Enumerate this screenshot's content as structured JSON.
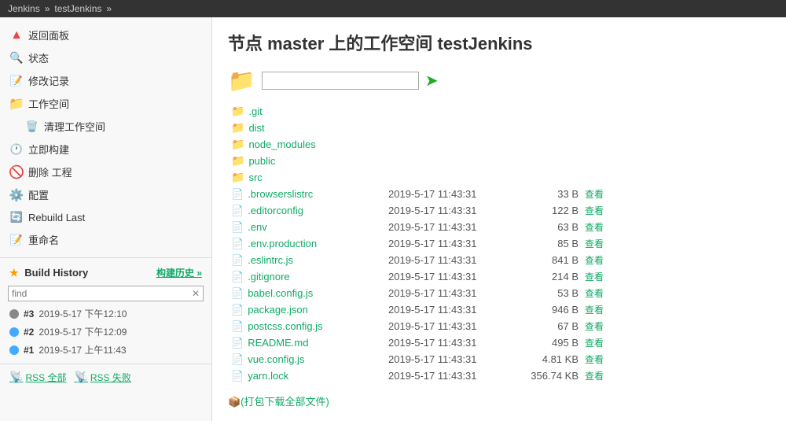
{
  "topbar": {
    "jenkins_label": "Jenkins",
    "sep1": "»",
    "project_label": "testJenkins",
    "sep2": "»"
  },
  "sidebar": {
    "back_label": "返回面板",
    "status_label": "状态",
    "changelog_label": "修改记录",
    "workspace_label": "工作空间",
    "clean_workspace_label": "清理工作空间",
    "build_now_label": "立即构建",
    "delete_label": "删除 工程",
    "config_label": "配置",
    "rebuild_label": "Rebuild Last",
    "rename_label": "重命名"
  },
  "build_history": {
    "title": "Build History",
    "link_label": "构建历史 »",
    "search_placeholder": "find",
    "builds": [
      {
        "id": "#3",
        "date": "2019-5-17 下午12:10",
        "status": "gray"
      },
      {
        "id": "#2",
        "date": "2019-5-17 下午12:09",
        "status": "blue"
      },
      {
        "id": "#1",
        "date": "2019-5-17 上午11:43",
        "status": "blue"
      }
    ],
    "rss_all": "RSS 全部",
    "rss_fail": "RSS 失败"
  },
  "main": {
    "title": "节点 master 上的工作空间 testJenkins",
    "folders": [
      {
        "name": ".git"
      },
      {
        "name": "dist"
      },
      {
        "name": "node_modules"
      },
      {
        "name": "public"
      },
      {
        "name": "src"
      }
    ],
    "files": [
      {
        "name": ".browserslistrc",
        "date": "2019-5-17 11:43:31",
        "size": "33 B",
        "action": "查看"
      },
      {
        "name": ".editorconfig",
        "date": "2019-5-17 11:43:31",
        "size": "122 B",
        "action": "查看"
      },
      {
        "name": ".env",
        "date": "2019-5-17 11:43:31",
        "size": "63 B",
        "action": "查看"
      },
      {
        "name": ".env.production",
        "date": "2019-5-17 11:43:31",
        "size": "85 B",
        "action": "查看"
      },
      {
        "name": ".eslintrc.js",
        "date": "2019-5-17 11:43:31",
        "size": "841 B",
        "action": "查看"
      },
      {
        "name": ".gitignore",
        "date": "2019-5-17 11:43:31",
        "size": "214 B",
        "action": "查看"
      },
      {
        "name": "babel.config.js",
        "date": "2019-5-17 11:43:31",
        "size": "53 B",
        "action": "查看"
      },
      {
        "name": "package.json",
        "date": "2019-5-17 11:43:31",
        "size": "946 B",
        "action": "查看"
      },
      {
        "name": "postcss.config.js",
        "date": "2019-5-17 11:43:31",
        "size": "67 B",
        "action": "查看"
      },
      {
        "name": "README.md",
        "date": "2019-5-17 11:43:31",
        "size": "495 B",
        "action": "查看"
      },
      {
        "name": "vue.config.js",
        "date": "2019-5-17 11:43:31",
        "size": "4.81 KB",
        "action": "查看"
      },
      {
        "name": "yarn.lock",
        "date": "2019-5-17 11:43:31",
        "size": "356.74 KB",
        "action": "查看"
      }
    ],
    "download_label": "📦(打包下载全部文件)"
  }
}
